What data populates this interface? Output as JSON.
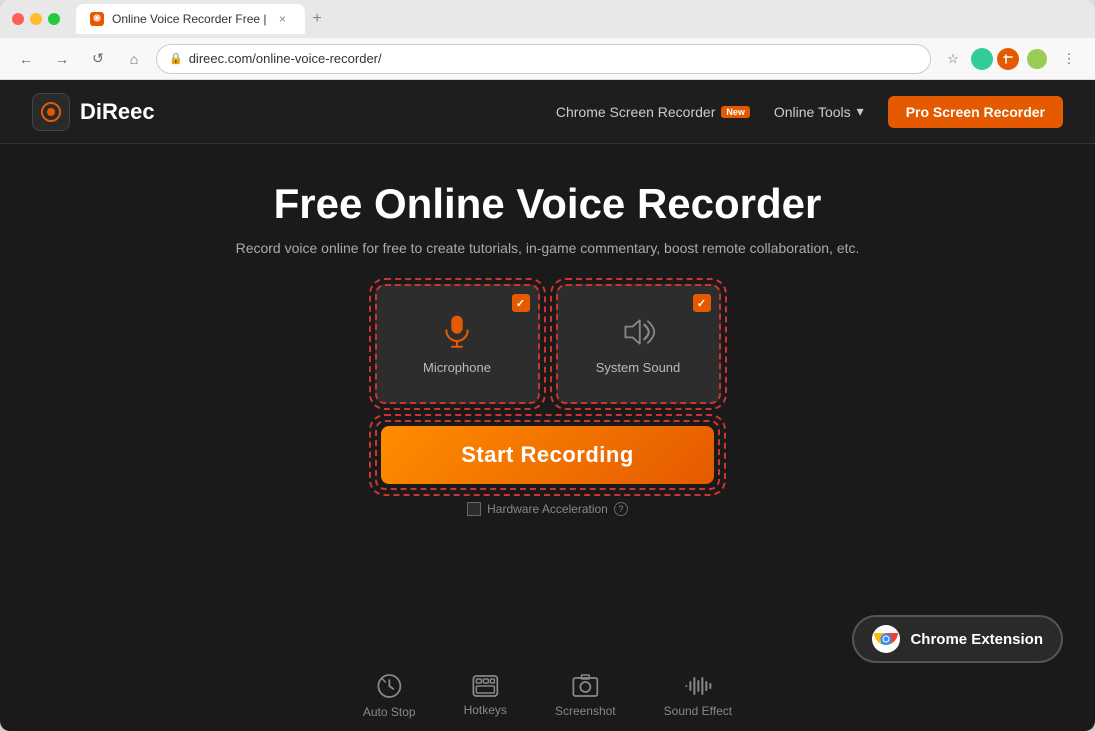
{
  "browser": {
    "tab_title": "Online Voice Recorder Free |",
    "tab_close": "×",
    "tab_new": "+",
    "url": "direec.com/online-voice-recorder/",
    "nav": {
      "back": "←",
      "forward": "→",
      "refresh": "↺",
      "home": "⌂"
    }
  },
  "header": {
    "logo_text": "DiReec",
    "nav_items": [
      {
        "label": "Chrome Screen Recorder",
        "badge": "New"
      },
      {
        "label": "Online Tools",
        "has_dropdown": true
      }
    ],
    "cta_label": "Pro Screen Recorder"
  },
  "main": {
    "title": "Free Online Voice Recorder",
    "subtitle": "Record voice online for free to create tutorials, in-game commentary, boost remote collaboration, etc.",
    "options": [
      {
        "id": "microphone",
        "label": "Microphone",
        "checked": true
      },
      {
        "id": "system-sound",
        "label": "System Sound",
        "checked": true
      }
    ],
    "start_btn": "Start Recording",
    "hw_accel_label": "Hardware Acceleration",
    "chrome_ext_label": "Chrome Extension"
  },
  "bottom_icons": [
    {
      "id": "auto-stop",
      "label": "Auto Stop"
    },
    {
      "id": "hotkeys",
      "label": "Hotkeys"
    },
    {
      "id": "screenshot",
      "label": "Screenshot"
    },
    {
      "id": "sound-effect",
      "label": "Sound Effect"
    }
  ]
}
